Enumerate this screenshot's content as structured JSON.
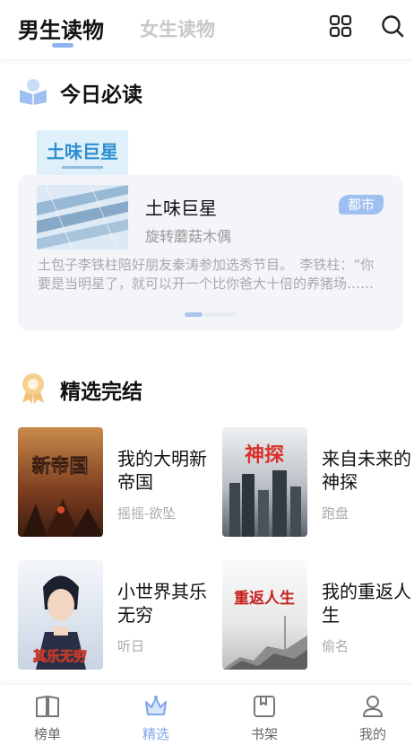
{
  "header": {
    "tabs": [
      {
        "label": "男生读物",
        "active": true
      },
      {
        "label": "女生读物",
        "active": false
      }
    ],
    "icons": [
      "grid-icon",
      "search-icon"
    ]
  },
  "today": {
    "section_title": "今日必读",
    "section_icon": "book-reading-icon",
    "book": {
      "title": "土味巨星",
      "author": "旋转蘑菇木偶",
      "genre": "都市",
      "cover_text": "土味巨星",
      "synopsis": "土包子李铁柱陪好朋友秦涛参加选秀节目。　李铁柱：“你要是当明星了，就可以开一个比你爸大十倍的养猪场……"
    }
  },
  "finished": {
    "section_title": "精选完结",
    "section_icon": "award-medal-icon",
    "books": [
      {
        "title": "我的大明新帝国",
        "author": "摇摇-欲坠",
        "cover_text": "新帝国"
      },
      {
        "title": "来自未来的神探",
        "author": "跑盘",
        "cover_text": "神探"
      },
      {
        "title": "小世界其乐无穷",
        "author": "听日",
        "cover_text": "其乐无穷"
      },
      {
        "title": "我的重返人生",
        "author": "偷名",
        "cover_text": "重返人生"
      }
    ]
  },
  "bottom_nav": [
    {
      "label": "榜单",
      "icon": "book-open-icon",
      "active": false
    },
    {
      "label": "精选",
      "icon": "crown-icon",
      "active": true
    },
    {
      "label": "书架",
      "icon": "bookshelf-icon",
      "active": false
    },
    {
      "label": "我的",
      "icon": "user-icon",
      "active": false
    }
  ],
  "colors": {
    "accent": "#8fb3f0",
    "tag_bg": "#9ec0f0",
    "muted_text": "#999999",
    "card_bg": "#f4f5f9"
  }
}
